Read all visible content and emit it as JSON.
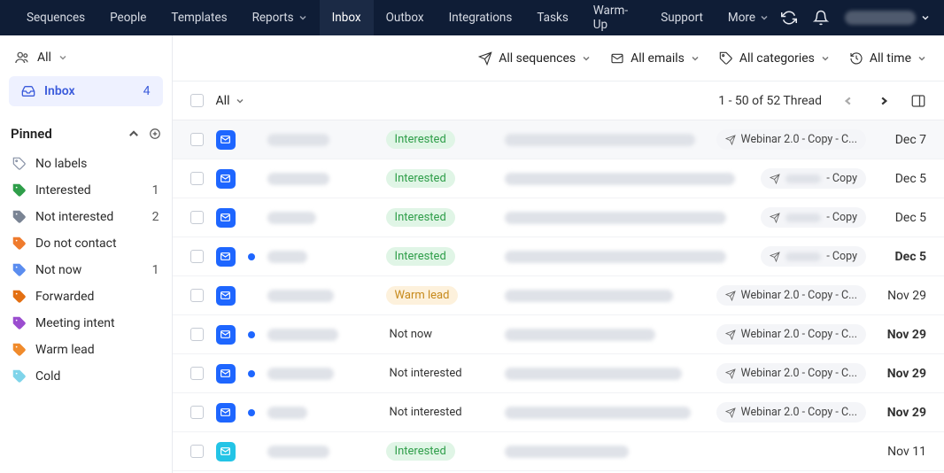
{
  "nav": {
    "items": [
      "Sequences",
      "People",
      "Templates",
      "Reports",
      "Inbox",
      "Outbox",
      "Integrations",
      "Tasks",
      "Warm-Up",
      "Support",
      "More"
    ],
    "active_index": 4,
    "dropdown_indices": [
      3,
      10
    ]
  },
  "sidebar": {
    "all_label": "All",
    "inbox": {
      "label": "Inbox",
      "count": "4"
    },
    "pinned_title": "Pinned",
    "labels": [
      {
        "name": "No labels",
        "count": "",
        "color": "#8892a6",
        "solid": false
      },
      {
        "name": "Interested",
        "count": "1",
        "color": "#2f9e4a",
        "solid": true
      },
      {
        "name": "Not interested",
        "count": "2",
        "color": "#7a8494",
        "solid": true
      },
      {
        "name": "Do not contact",
        "count": "",
        "color": "#ef7b2d",
        "solid": true
      },
      {
        "name": "Not now",
        "count": "1",
        "color": "#5b8def",
        "solid": true
      },
      {
        "name": "Forwarded",
        "count": "",
        "color": "#e36f12",
        "solid": true
      },
      {
        "name": "Meeting intent",
        "count": "",
        "color": "#9b4dcf",
        "solid": true
      },
      {
        "name": "Warm lead",
        "count": "",
        "color": "#f08b2c",
        "solid": true
      },
      {
        "name": "Cold",
        "count": "",
        "color": "#7fd4ea",
        "solid": true
      }
    ]
  },
  "toolbar": {
    "sequences": "All sequences",
    "emails": "All emails",
    "categories": "All categories",
    "time": "All time"
  },
  "thead": {
    "all_label": "All",
    "range": "1 - 50  of  52  Thread"
  },
  "rows": [
    {
      "hover": true,
      "unread": false,
      "status": "Interested",
      "status_class": "status-interested",
      "preview_w": 215,
      "sender_w": 70,
      "seq": "Webinar 2.0 - Copy - C...",
      "seq_blur": false,
      "date": "Dec 7",
      "bold": false,
      "color": "blue"
    },
    {
      "hover": false,
      "unread": false,
      "status": "Interested",
      "status_class": "status-interested",
      "preview_w": 260,
      "sender_w": 70,
      "seq": "- Copy",
      "seq_blur": true,
      "date": "Dec 5",
      "bold": false,
      "color": "blue"
    },
    {
      "hover": false,
      "unread": false,
      "status": "Interested",
      "status_class": "status-interested",
      "preview_w": 250,
      "sender_w": 55,
      "seq": "- Copy",
      "seq_blur": true,
      "date": "Dec 5",
      "bold": false,
      "color": "blue"
    },
    {
      "hover": false,
      "unread": true,
      "status": "Interested",
      "status_class": "status-interested",
      "preview_w": 250,
      "sender_w": 45,
      "seq": "- Copy",
      "seq_blur": true,
      "date": "Dec 5",
      "bold": true,
      "color": "blue"
    },
    {
      "hover": false,
      "unread": false,
      "status": "Warm lead",
      "status_class": "status-warm",
      "preview_w": 190,
      "sender_w": 75,
      "seq": "Webinar 2.0 - Copy - C...",
      "seq_blur": false,
      "date": "Nov 29",
      "bold": false,
      "color": "blue"
    },
    {
      "hover": false,
      "unread": true,
      "status": "Not now",
      "status_class": "status-plain",
      "preview_w": 170,
      "sender_w": 80,
      "seq": "Webinar 2.0 - Copy - C...",
      "seq_blur": false,
      "date": "Nov 29",
      "bold": true,
      "color": "blue"
    },
    {
      "hover": false,
      "unread": true,
      "status": "Not interested",
      "status_class": "status-plain",
      "preview_w": 200,
      "sender_w": 75,
      "seq": "Webinar 2.0 - Copy - C...",
      "seq_blur": false,
      "date": "Nov 29",
      "bold": true,
      "color": "blue"
    },
    {
      "hover": false,
      "unread": true,
      "status": "Not interested",
      "status_class": "status-plain",
      "preview_w": 210,
      "sender_w": 45,
      "seq": "Webinar 2.0 - Copy - C...",
      "seq_blur": false,
      "date": "Nov 29",
      "bold": true,
      "color": "blue"
    },
    {
      "hover": false,
      "unread": false,
      "status": "Interested",
      "status_class": "status-interested",
      "preview_w": 140,
      "sender_w": 70,
      "seq": "",
      "seq_blur": false,
      "seq_hide": true,
      "date": "Nov 11",
      "bold": false,
      "color": "cyan"
    }
  ]
}
